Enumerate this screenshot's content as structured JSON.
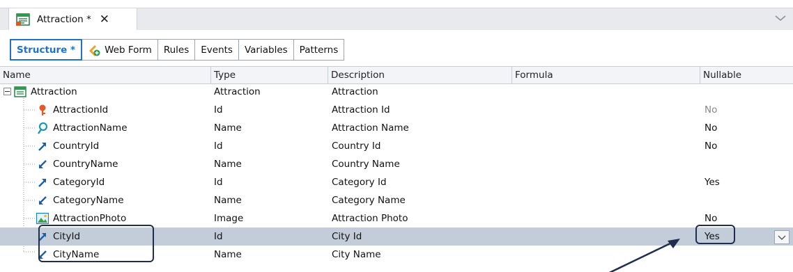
{
  "doc_tab": {
    "title": "Attraction",
    "modified_mark": "*",
    "close_glyph": "✕"
  },
  "sub_tabs": [
    {
      "label": "Structure *",
      "active": true
    },
    {
      "label": "Web Form",
      "active": false
    },
    {
      "label": "Rules",
      "active": false
    },
    {
      "label": "Events",
      "active": false
    },
    {
      "label": "Variables",
      "active": false
    },
    {
      "label": "Patterns",
      "active": false
    }
  ],
  "columns": [
    "Name",
    "Type",
    "Description",
    "Formula",
    "Nullable"
  ],
  "rows": [
    {
      "name": "Attraction",
      "type": "Attraction",
      "description": "Attraction",
      "formula": "",
      "nullable": "",
      "icon": "transaction-icon"
    },
    {
      "name": "AttractionId",
      "type": "Id",
      "description": "Attraction Id",
      "formula": "",
      "nullable": "No",
      "icon": "primary-key-icon"
    },
    {
      "name": "AttractionName",
      "type": "Name",
      "description": "Attraction Name",
      "formula": "",
      "nullable": "No",
      "icon": "index-search-icon"
    },
    {
      "name": "CountryId",
      "type": "Id",
      "description": "Country Id",
      "formula": "",
      "nullable": "No",
      "icon": "foreign-key-icon"
    },
    {
      "name": "CountryName",
      "type": "Name",
      "description": "Country Name",
      "formula": "",
      "nullable": "",
      "icon": "inferred-attribute-icon"
    },
    {
      "name": "CategoryId",
      "type": "Id",
      "description": "Category Id",
      "formula": "",
      "nullable": "Yes",
      "icon": "foreign-key-icon"
    },
    {
      "name": "CategoryName",
      "type": "Name",
      "description": "Category Name",
      "formula": "",
      "nullable": "",
      "icon": "inferred-attribute-icon"
    },
    {
      "name": "AttractionPhoto",
      "type": "Image",
      "description": "Attraction Photo",
      "formula": "",
      "nullable": "No",
      "icon": "image-icon"
    },
    {
      "name": "CityId",
      "type": "Id",
      "description": "City Id",
      "formula": "",
      "nullable": "Yes",
      "icon": "foreign-key-icon",
      "selected": true
    },
    {
      "name": "CityName",
      "type": "Name",
      "description": "City Name",
      "formula": "",
      "nullable": "",
      "icon": "inferred-attribute-icon"
    }
  ],
  "colors": {
    "accent": "#1e73c8",
    "selection": "#c3cdd9",
    "annotation": "#1f2d4e"
  }
}
